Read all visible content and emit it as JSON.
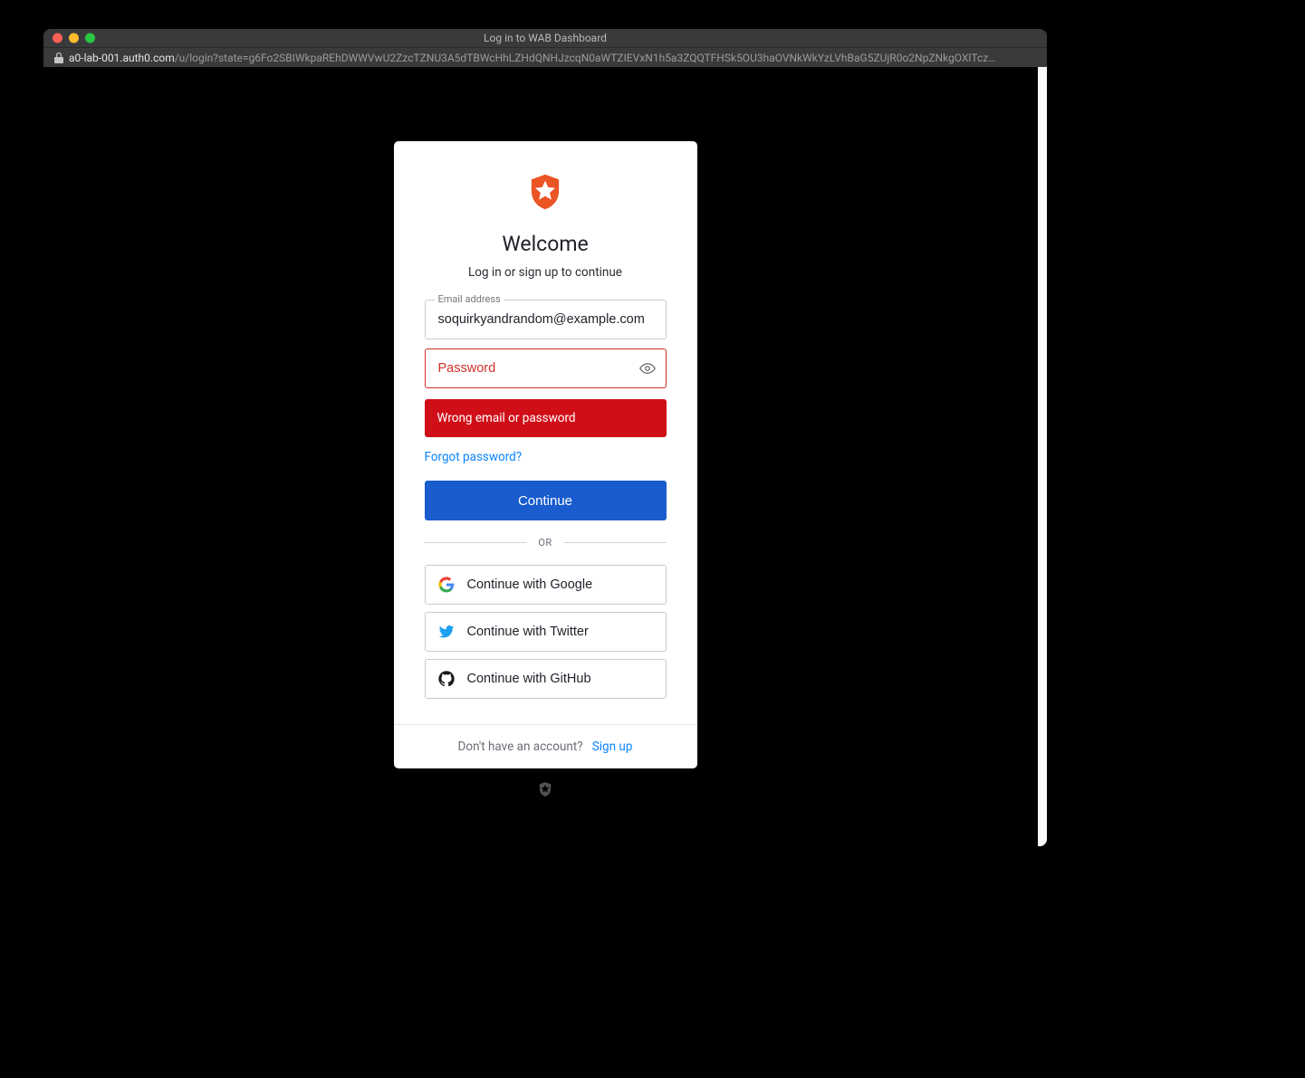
{
  "window": {
    "title": "Log in to WAB Dashboard",
    "url_domain": "a0-lab-001.auth0.com",
    "url_path": "/u/login?state=g6Fo2SBIWkpaREhDWWVwU2ZzcTZNU3A5dTBWcHhLZHdQNHJzcqN0aWTZIEVxN1h5a3ZQQTFHSk5OU3haOVNkWkYzLVhBaG5ZUjR0o2NpZNkgOXlTcz…"
  },
  "login": {
    "welcome": "Welcome",
    "subtitle": "Log in or sign up to continue",
    "email_label": "Email address",
    "email_value": "soquirkyandrandom@example.com",
    "password_placeholder": "Password",
    "error_message": "Wrong email or password",
    "forgot_label": "Forgot password?",
    "continue_label": "Continue",
    "divider_label": "OR",
    "social": {
      "google": "Continue with Google",
      "twitter": "Continue with Twitter",
      "github": "Continue with GitHub"
    }
  },
  "footer": {
    "prompt": "Don't have an account?",
    "signup_label": "Sign up"
  }
}
